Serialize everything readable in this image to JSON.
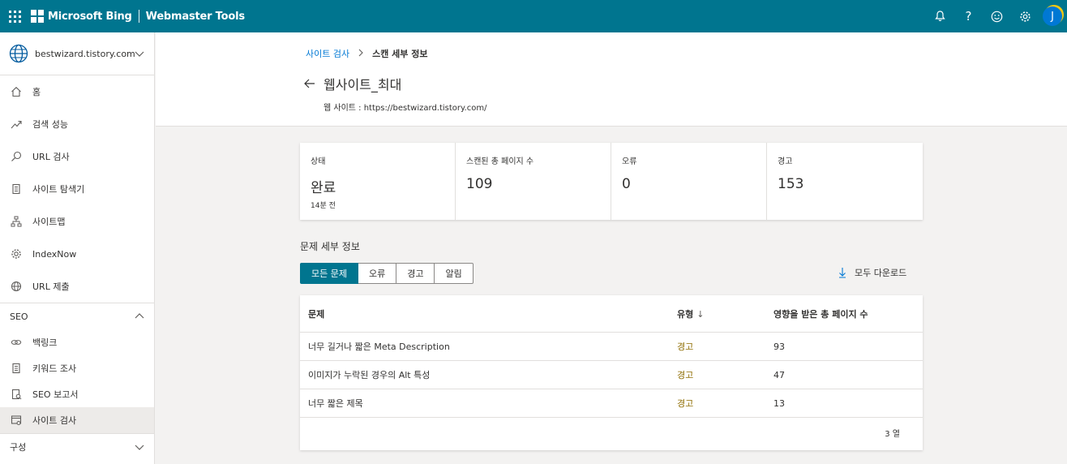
{
  "topbar": {
    "brand": "Microsoft Bing",
    "product": "Webmaster Tools",
    "avatar_initial": "J",
    "icons": [
      "bell-icon",
      "help-icon",
      "feedback-smiley-icon",
      "gear-icon"
    ]
  },
  "sidebar": {
    "site": "bestwizard.tistory.com",
    "items": [
      {
        "label": "홈",
        "icon": "home-icon"
      },
      {
        "label": "검색 성능",
        "icon": "trend-icon"
      },
      {
        "label": "URL 검사",
        "icon": "search-icon"
      },
      {
        "label": "사이트 탐색기",
        "icon": "document-icon"
      },
      {
        "label": "사이트맵",
        "icon": "sitemap-icon"
      },
      {
        "label": "IndexNow",
        "icon": "gear-icon"
      },
      {
        "label": "URL 제출",
        "icon": "globe-icon"
      }
    ],
    "seo_section": "SEO",
    "seo_items": [
      {
        "label": "백링크",
        "icon": "link-icon"
      },
      {
        "label": "키워드 조사",
        "icon": "document-icon"
      },
      {
        "label": "SEO 보고서",
        "icon": "report-icon"
      },
      {
        "label": "사이트 검사",
        "icon": "scan-icon"
      }
    ],
    "config_section": "구성"
  },
  "header": {
    "breadcrumb_parent": "사이트 검사",
    "breadcrumb_current": "스캔 세부 정보",
    "title": "웹사이트_최대",
    "subtitle": "웹 사이트 : https://bestwizard.tistory.com/"
  },
  "summary": {
    "status_label": "상태",
    "status_value": "완료",
    "status_time": "14분 전",
    "pages_label": "스캔된 총 페이지 수",
    "pages_value": "109",
    "errors_label": "오류",
    "errors_value": "0",
    "warnings_label": "경고",
    "warnings_value": "153"
  },
  "issues": {
    "title": "문제 세부 정보",
    "filters": [
      "모든 문제",
      "오류",
      "경고",
      "알림"
    ],
    "active_filter": "모든 문제",
    "download": "모두 다운로드",
    "columns": [
      "문제",
      "유형",
      "영향을 받은 총 페이지 수"
    ],
    "rows": [
      {
        "issue": "너무 길거나 짧은 Meta Description",
        "type": "경고",
        "pages": "93"
      },
      {
        "issue": "이미지가 누락된 경우의 Alt 특성",
        "type": "경고",
        "pages": "47"
      },
      {
        "issue": "너무 짧은 제목",
        "type": "경고",
        "pages": "13"
      }
    ],
    "row_count": "3 열"
  },
  "colors": {
    "topbar": "#00758f",
    "link": "#0078d4",
    "warning": "#8e6c00"
  }
}
